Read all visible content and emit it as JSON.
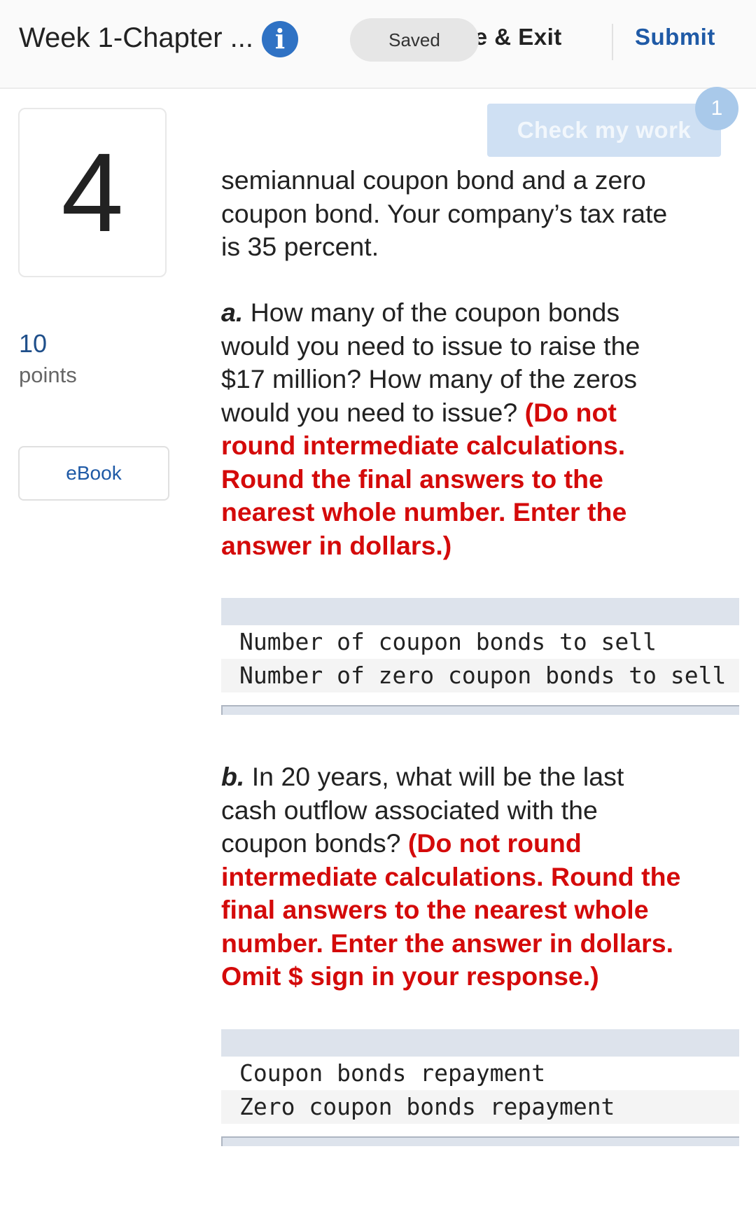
{
  "header": {
    "title": "Week 1-Chapter ...",
    "info_icon": "info-icon",
    "saved_label": "Saved",
    "save_exit_label": "ave & Exit",
    "submit_label": "Submit"
  },
  "question": {
    "number": "4",
    "points_value": "10",
    "points_label": "points",
    "ebook_label": "eBook",
    "check_work_label": "Check my work",
    "attempt_count": "1",
    "intro_lines": [
      "semiannual coupon bond and a zero",
      "coupon bond. Your company’s tax rate",
      "is 35 percent."
    ]
  },
  "part_a": {
    "label": "a.",
    "line1": " How many of the coupon bonds",
    "line2": "would you need to issue to raise the",
    "line3": "$17 million? How many of the zeros",
    "line4_plain": "would you need to issue? ",
    "line4_red": "(Do not",
    "red_lines": [
      "round intermediate calculations.",
      "Round the final answers to the",
      "nearest whole number. Enter the",
      "answer in dollars.)"
    ],
    "rows": [
      "Number of coupon bonds to sell",
      "Number of zero coupon bonds to sell"
    ]
  },
  "part_b": {
    "label": "b.",
    "line1": " In 20 years, what will be the last",
    "line2": "cash outflow associated with the",
    "line3_plain": "coupon bonds? ",
    "line3_red": "(Do not round",
    "red_lines": [
      "intermediate calculations. Round the",
      "final answers to the nearest whole",
      "number. Enter the answer in dollars.",
      "Omit $ sign in your response.)"
    ],
    "rows": [
      "Coupon bonds repayment",
      "Zero coupon bonds repayment"
    ]
  },
  "colors": {
    "accent_blue": "#1f5aa6",
    "info_blue": "#2f72c4",
    "instruction_red": "#d40a0a",
    "table_header": "#dde3ec"
  }
}
